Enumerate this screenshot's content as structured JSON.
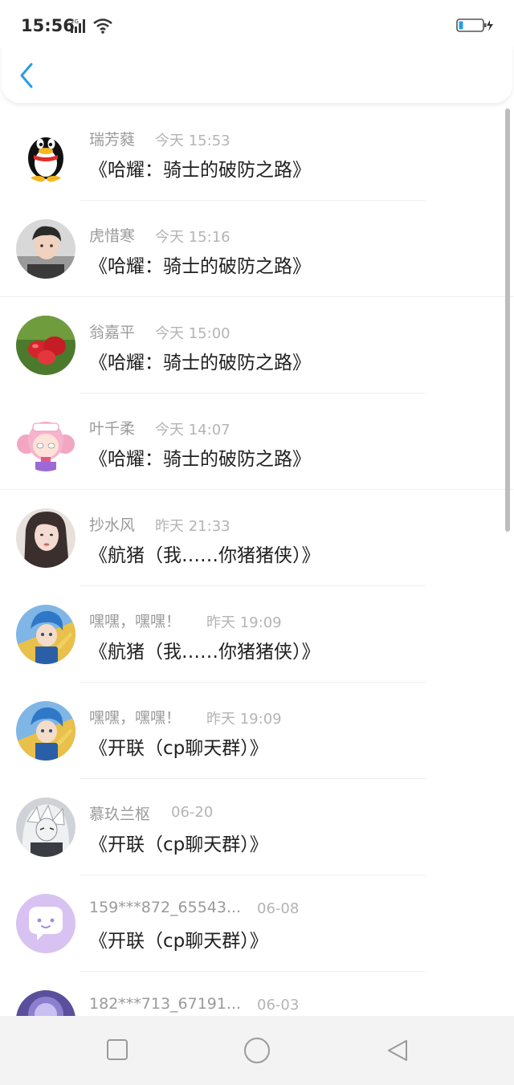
{
  "status_bar": {
    "time": "15:56",
    "network": "2G"
  },
  "conversations": [
    {
      "name": "瑞芳蕤",
      "time": "今天 15:53",
      "message": "《哈耀：骑士的破防之路》",
      "avatar": "qq-penguin-icon"
    },
    {
      "name": "虎惜寒",
      "time": "今天 15:16",
      "message": "《哈耀：骑士的破防之路》",
      "avatar": "boy-photo"
    },
    {
      "name": "翁嘉平",
      "time": "今天 15:00",
      "message": "《哈耀：骑士的破防之路》",
      "avatar": "red-fruit-photo"
    },
    {
      "name": "叶千柔",
      "time": "今天 14:07",
      "message": "《哈耀：骑士的破防之路》",
      "avatar": "pink-anime-girl"
    },
    {
      "name": "抄水风",
      "time": "昨天 21:33",
      "message": "《航猪（我……你猪猪侠）》",
      "avatar": "girl-photo"
    },
    {
      "name": "嘿嘿，嘿嘿！",
      "time": "昨天 19:09",
      "message": "《航猪（我……你猪猪侠）》",
      "avatar": "blue-hair-character"
    },
    {
      "name": "嘿嘿，嘿嘿！",
      "time": "昨天 19:09",
      "message": "《开联（cp聊天群）》",
      "avatar": "blue-hair-character"
    },
    {
      "name": "慕玖兰枢",
      "time": "06-20",
      "message": "《开联（cp聊天群）》",
      "avatar": "white-hair-anime"
    },
    {
      "name": "159***872_65543...",
      "time": "06-08",
      "message": "《开联（cp聊天群）》",
      "avatar": "chat-bubble-icon"
    },
    {
      "name": "182***713_67191...",
      "time": "06-03",
      "message": "",
      "avatar": "purple-character"
    }
  ],
  "colors": {
    "accent": "#2a9de0",
    "name_text": "#9a9a9a",
    "time_text": "#b4b4b4",
    "message_text": "#1f1f1f"
  },
  "nav_bar": {
    "buttons": [
      "square-icon",
      "circle-icon",
      "triangle-back-icon"
    ]
  }
}
